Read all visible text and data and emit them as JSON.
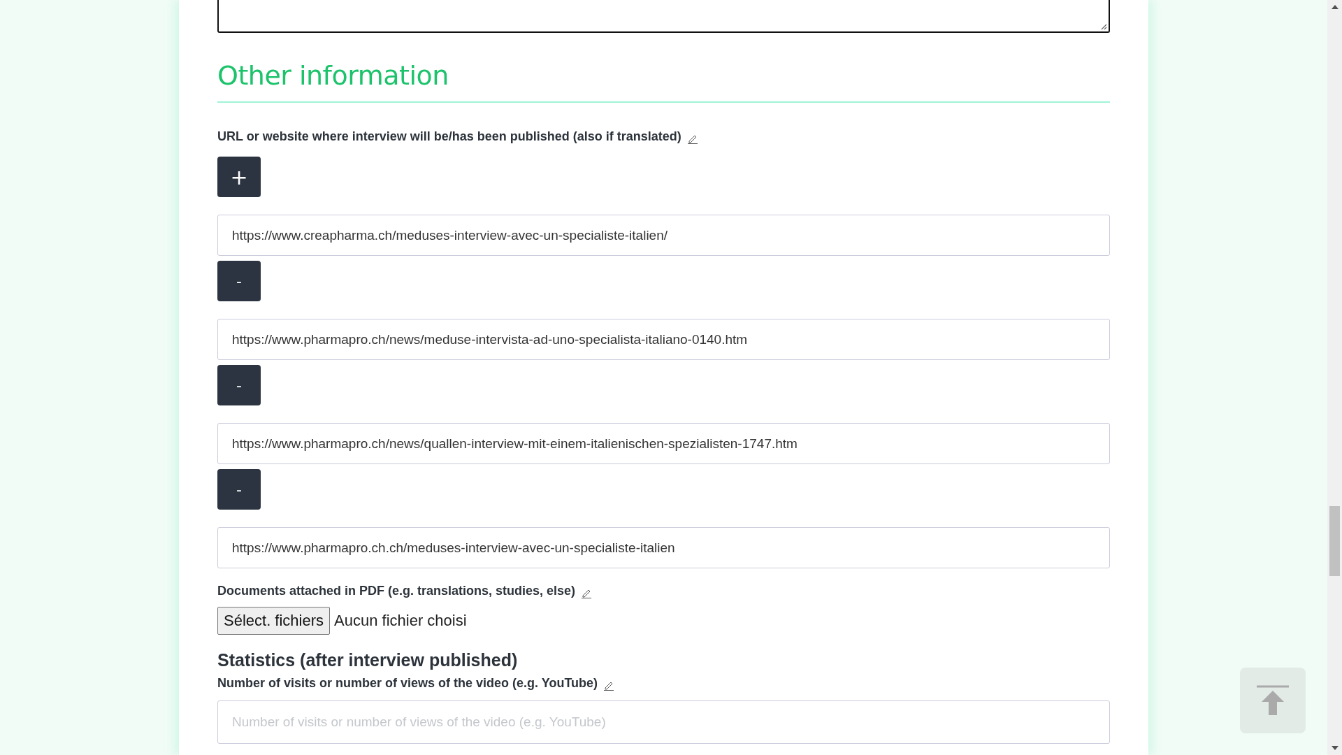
{
  "section_title": "Other information",
  "url_group": {
    "label": "URL or website where interview will be/has been published (also if translated)",
    "add_button": "+",
    "entries": [
      {
        "value": "https://www.creapharma.ch/meduses-interview-avec-un-specialiste-italien/",
        "remove_button": "-"
      },
      {
        "value": "https://www.pharmapro.ch/news/meduse-intervista-ad-uno-specialista-italiano-0140.htm",
        "remove_button": "-"
      },
      {
        "value": "https://www.pharmapro.ch/news/quallen-interview-mit-einem-italienischen-spezialisten-1747.htm",
        "remove_button": "-"
      },
      {
        "value": "https://www.pharmapro.ch.ch/meduses-interview-avec-un-specialiste-italien"
      }
    ]
  },
  "documents": {
    "label": "Documents attached in PDF (e.g. translations, studies, else)",
    "button": "Sélect. fichiers",
    "status": "Aucun fichier choisi"
  },
  "statistics": {
    "title": "Statistics (after interview published)",
    "label": "Number of visits or number of views of the video (e.g. YouTube)",
    "placeholder": "Number of visits or number of views of the video (e.g. YouTube)"
  }
}
